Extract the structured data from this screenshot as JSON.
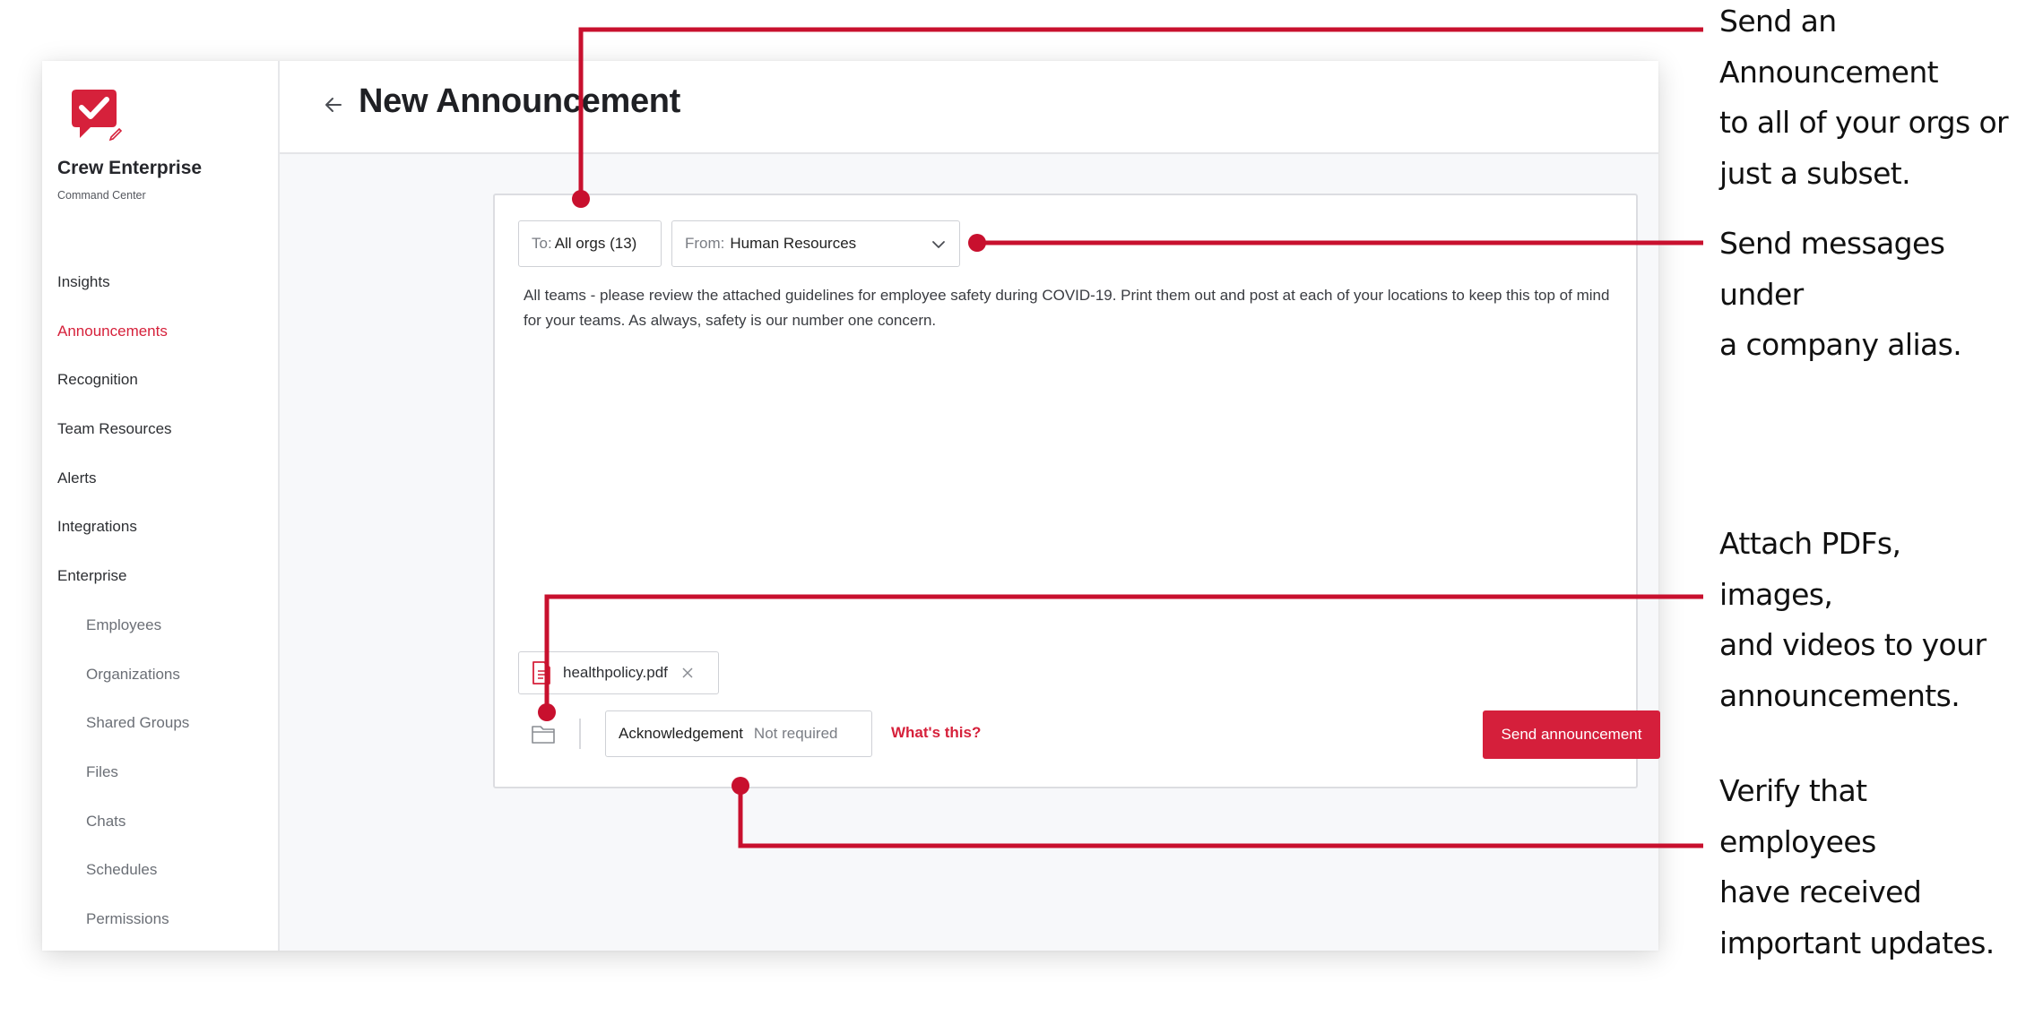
{
  "colors": {
    "accent": "#d6213b",
    "line": "#c8102e"
  },
  "brand": {
    "title": "Crew Enterprise",
    "subtitle": "Command Center",
    "logo_icon": "checkmark-chat-bubble-icon"
  },
  "nav": {
    "items": [
      {
        "label": "Insights"
      },
      {
        "label": "Announcements",
        "active": true
      },
      {
        "label": "Recognition"
      },
      {
        "label": "Team Resources"
      },
      {
        "label": "Alerts"
      },
      {
        "label": "Integrations"
      },
      {
        "label": "Enterprise"
      },
      {
        "label": "Employees",
        "sub": true
      },
      {
        "label": "Organizations",
        "sub": true
      },
      {
        "label": "Shared Groups",
        "sub": true
      },
      {
        "label": "Files",
        "sub": true
      },
      {
        "label": "Chats",
        "sub": true
      },
      {
        "label": "Schedules",
        "sub": true
      },
      {
        "label": "Permissions",
        "sub": true
      }
    ]
  },
  "header": {
    "title": "New Announcement",
    "back_icon": "back-arrow-icon"
  },
  "composer": {
    "to_label": "To:",
    "to_value": "All orgs (13)",
    "from_label": "From:",
    "from_value": "Human Resources",
    "message": "All teams - please review the attached guidelines for employee safety during COVID-19. Print them out and post at each of your locations to keep this top of mind for your teams. As always, safety is our number one concern.",
    "attachment_name": "healthpolicy.pdf",
    "ack_label": "Acknowledgement",
    "ack_value": "Not required",
    "whats_this": "What's this?",
    "send_label": "Send announcement"
  },
  "callouts": [
    "Send an\nAnnouncement\nto all of your orgs or\njust a subset.",
    "Send messages under\na company alias.",
    "Attach PDFs, images,\nand videos to your\nannouncements.",
    "Verify that employees\nhave received\nimportant updates."
  ]
}
